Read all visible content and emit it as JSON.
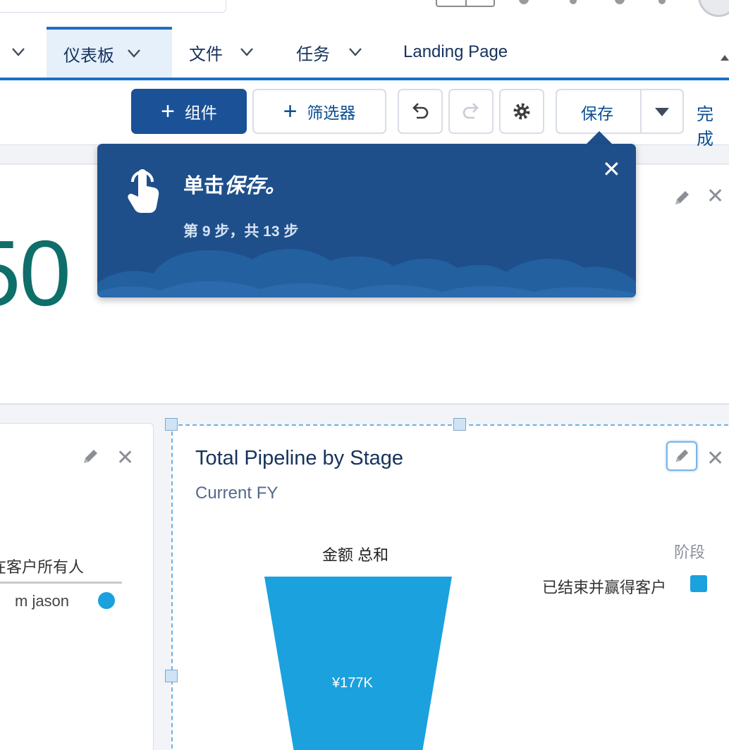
{
  "nav": {
    "items": [
      {
        "label": "仪表板",
        "active": true
      },
      {
        "label": "文件",
        "active": false
      },
      {
        "label": "任务",
        "active": false
      },
      {
        "label": "Landing Page",
        "active": false
      }
    ]
  },
  "toolbar": {
    "add_component_label": "组件",
    "add_filter_label": "筛选器",
    "save_label": "保存",
    "done_label": "完成"
  },
  "metric": {
    "value_fragment": "50"
  },
  "popover": {
    "title_plain": "单击",
    "title_italic": "保存。",
    "step_text": "第 9 步，共 13 步",
    "close_symbol": "✕"
  },
  "left_card": {
    "legend_title": "潜在客户所有人",
    "legend_items": [
      {
        "label": "m jason",
        "color": "#1ba1de"
      }
    ]
  },
  "right_card": {
    "title": "Total Pipeline by Stage",
    "subtitle": "Current FY",
    "measure_label": "金额 总和",
    "legend_title": "阶段",
    "legend_items": [
      {
        "label": "已结束并赢得客户",
        "color": "#1ba1de"
      }
    ]
  },
  "chart_data": {
    "type": "funnel",
    "title": "Total Pipeline by Stage",
    "subtitle": "Current FY",
    "measure": "金额 总和",
    "legend_title": "阶段",
    "categories": [
      "已结束并赢得客户"
    ],
    "values": [
      177000
    ],
    "value_labels": [
      "¥177K"
    ],
    "colors": [
      "#1ba1de"
    ]
  },
  "colors": {
    "brand_blue": "#1b5297",
    "nav_accent": "#1b6fc8",
    "popover_bg": "#1e4f8b",
    "metric_teal": "#0e6e6a",
    "series_blue": "#1ba1de"
  }
}
